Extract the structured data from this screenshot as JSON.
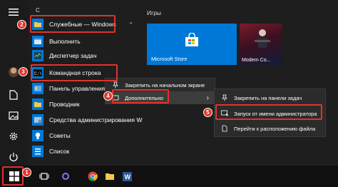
{
  "start_menu": {
    "letter_header": "С",
    "apps": [
      {
        "label": "Служебные — Windows",
        "icon": "folder-icon",
        "expanded": true
      },
      {
        "label": "Выполнить",
        "icon": "run-icon"
      },
      {
        "label": "Диспетчер задач",
        "icon": "task-manager-icon"
      },
      {
        "label": "Командная строка",
        "icon": "cmd-icon"
      },
      {
        "label": "Панель управления",
        "icon": "control-panel-icon"
      },
      {
        "label": "Проводник",
        "icon": "explorer-icon"
      },
      {
        "label": "Средства администрирования Wi...",
        "icon": "admin-tools-icon"
      },
      {
        "label": "Советы",
        "icon": "tips-icon"
      },
      {
        "label": "Список",
        "icon": "list-icon"
      }
    ]
  },
  "tiles": {
    "group_title": "Игры",
    "store_label": "Microsoft Store",
    "game_label": "Modern Co..."
  },
  "context_menu": {
    "items": [
      {
        "label": "Закрепить на начальном экране",
        "icon": "pin-icon"
      },
      {
        "label": "Дополнительно",
        "icon": "more-icon",
        "submenu_arrow": "›"
      }
    ]
  },
  "submenu": {
    "items": [
      {
        "label": "Закрепить на панели задач",
        "icon": "pin-taskbar-icon"
      },
      {
        "label": "Запуск от имени администратора",
        "icon": "run-as-admin-icon"
      },
      {
        "label": "Перейти к расположению файла",
        "icon": "open-location-icon"
      }
    ]
  },
  "steps": [
    "1",
    "2",
    "3",
    "4",
    "5"
  ],
  "colors": {
    "accent": "#0078d7",
    "highlight": "#e0332a",
    "menu_bg": "#2b2b2b",
    "start_bg": "#1e1e1e",
    "taskbar_bg": "#101010"
  }
}
